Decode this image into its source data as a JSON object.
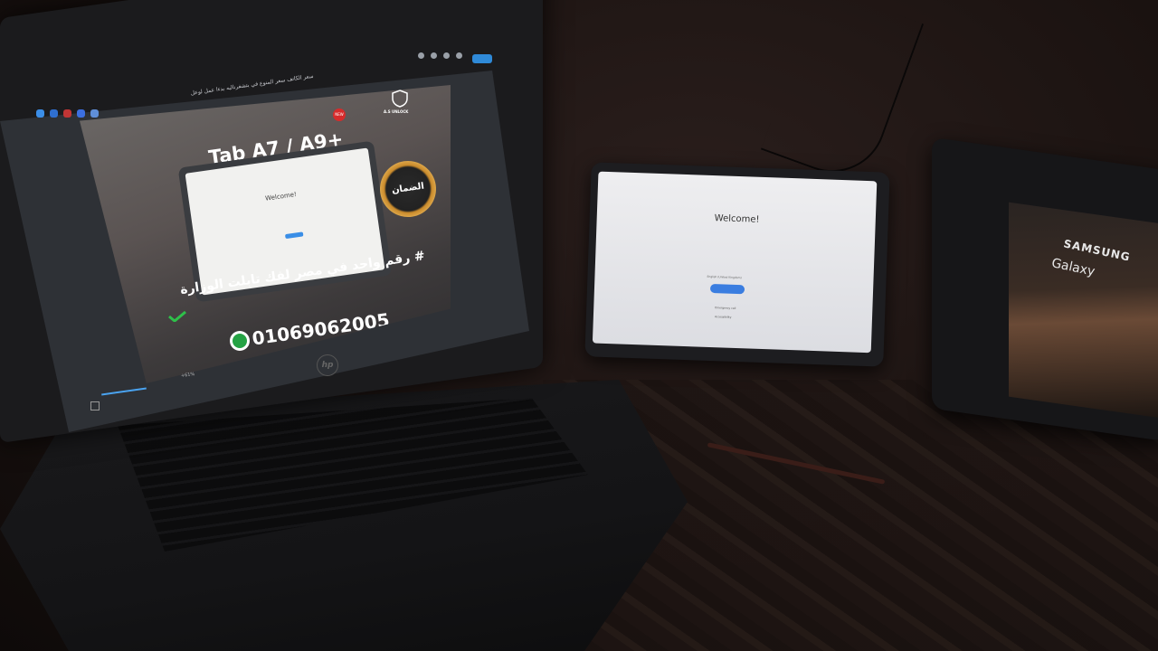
{
  "scene": {
    "description_labels": {
      "laptop_brand": "hp",
      "tablet_mid_welcome": "Welcome!",
      "tablet_right_brand_line1": "SAMSUNG",
      "tablet_right_brand_line2": "Galaxy"
    }
  },
  "laptop_screen": {
    "window_title": "سعر الكاتف سعر المنوع في بتشفرنالبه بدءا عمل لوعل",
    "ad": {
      "title": "Tab A7 / A9+",
      "hashtag": "# رقم واحد في مصر لفك تابلت الوزارة",
      "tagline": "",
      "phone": "01069062005",
      "mock_welcome": "Welcome!",
      "badge_text": "الضمان",
      "logo_label": "A.S UNLOCK",
      "new_badge": "NEW"
    },
    "viewer": {
      "zoom_value": "+61%"
    }
  },
  "tablet_mid": {
    "welcome": "Welcome!",
    "language": "English (United Kingdom)",
    "start_label": "Start",
    "link_1": "Emergency call",
    "link_2": "Accessibility"
  },
  "tablet_right": {
    "brand_line1": "SAMSUNG",
    "brand_line2": "Galaxy"
  },
  "colors": {
    "accent_blue": "#3a7de0",
    "whatsapp_green": "#25a244",
    "badge_gold": "#e4b155"
  }
}
